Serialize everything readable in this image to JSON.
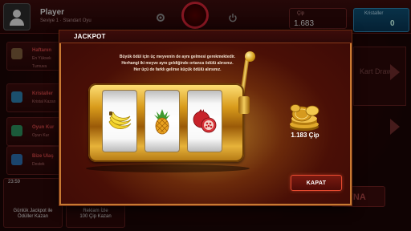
{
  "lobby": {
    "player_name": "Player",
    "player_sub": "Seviye 1 · Standart Oyu",
    "chip_label": "Çip",
    "chip_amount": "1.683",
    "blue_label": "Kristaller",
    "blue_amount": "0",
    "side_cards": [
      {
        "title": "Haftanın",
        "sub": "En Yüksek",
        "sub2": "Turnuva"
      },
      {
        "title": "Kristaller",
        "sub": "Kristal Kazan"
      },
      {
        "title": "Oyun Kur",
        "sub": "Oyun Kur"
      },
      {
        "title": "Bize Ulaş",
        "sub": "Destek"
      }
    ],
    "right_panel_text": "Kart Draw",
    "oyna_label": "OYNA",
    "timer": "23:59",
    "bottom_tiles": [
      {
        "label": "Günlük Jackpot ile\nÖdüller Kazan"
      },
      {
        "label": "Reklam İzle\n100 Çip Kazan"
      }
    ]
  },
  "dialog": {
    "title": "JACKPOT",
    "description_lines": [
      "Büyük ödül için üç meyvenin de aynı gelmesi gerekmektedir.",
      "Herhangi iki meyve aynı geldiğinde ortanca ödülü alırsınız.",
      "Her üçü de farklı gelirse küçük ödülü alırsınız."
    ],
    "reels": [
      {
        "symbol": "banana-icon"
      },
      {
        "symbol": "pineapple-icon"
      },
      {
        "symbol": "pomegranate-icon"
      }
    ],
    "chip_value": "1.183 Çip",
    "close_label": "KAPAT"
  },
  "colors": {
    "dialog_border": "#c87a33",
    "close_border": "#e4492f",
    "gold": "#d99c1c"
  }
}
